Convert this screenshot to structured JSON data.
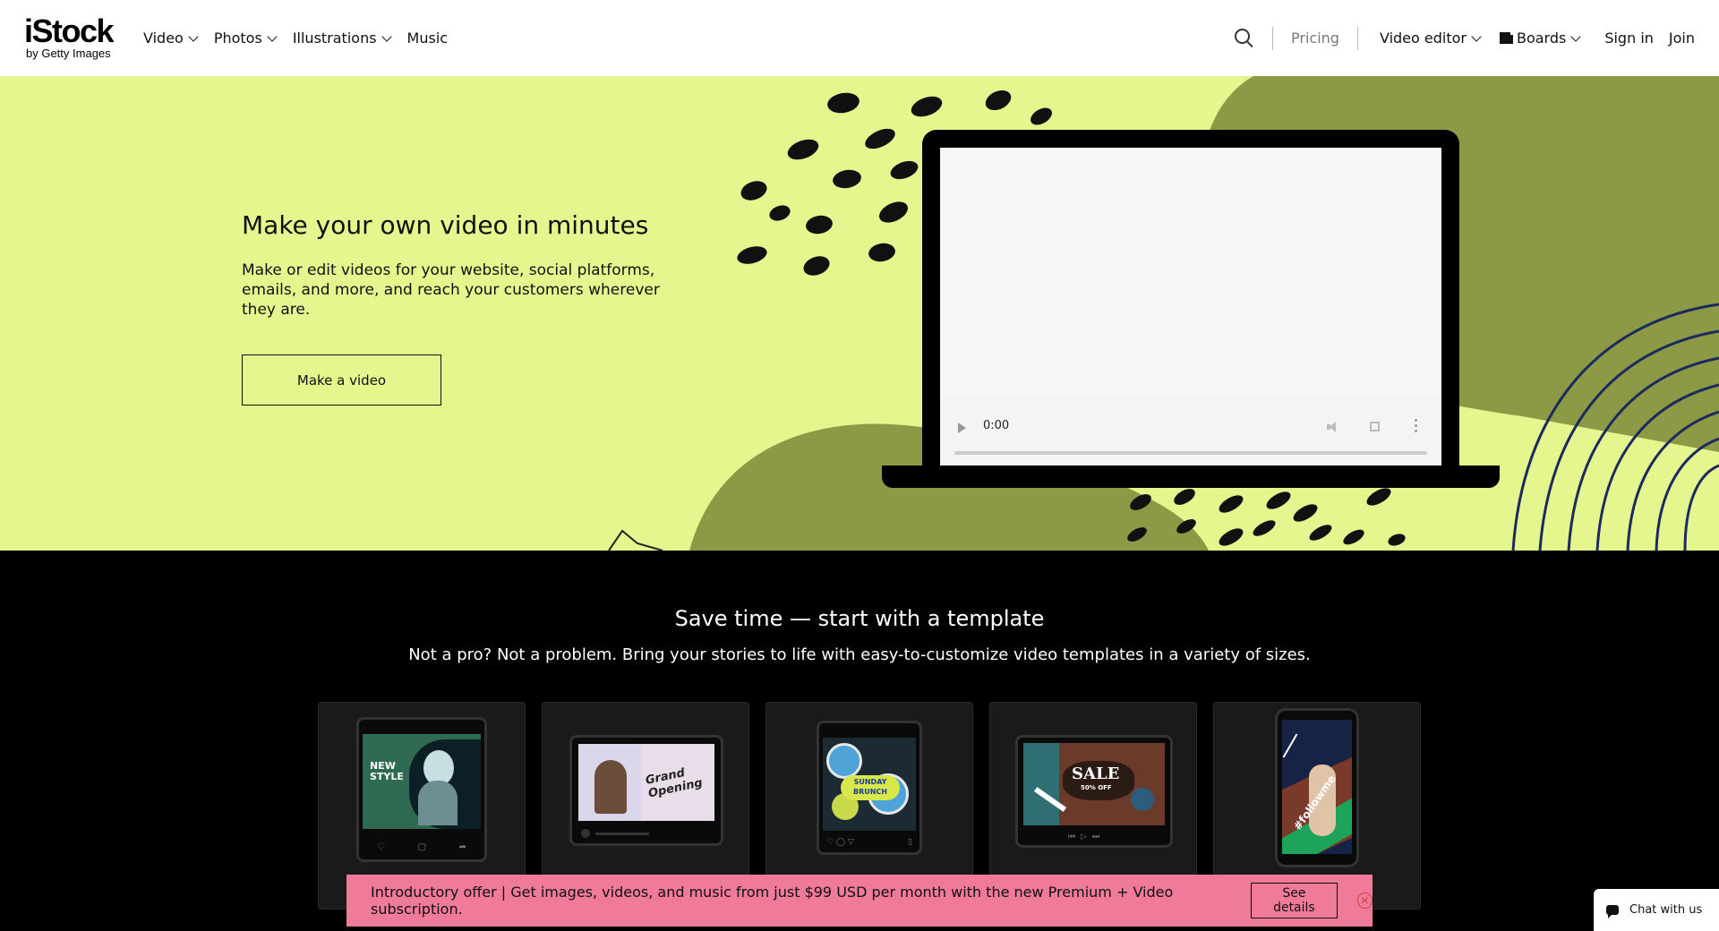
{
  "brand": {
    "name": "iStock",
    "byline": "by Getty Images"
  },
  "nav": {
    "left": [
      {
        "label": "Video",
        "dropdown": true
      },
      {
        "label": "Photos",
        "dropdown": true
      },
      {
        "label": "Illustrations",
        "dropdown": true
      },
      {
        "label": "Music",
        "dropdown": false
      }
    ],
    "pricing": "Pricing",
    "video_editor": "Video editor",
    "boards": "Boards",
    "sign_in": "Sign in",
    "join": "Join"
  },
  "hero": {
    "title": "Make your own video in minutes",
    "description": "Make or edit videos for your website, social platforms, emails, and more, and reach your customers wherever they are.",
    "cta": "Make a video",
    "background_color": "#e6f68e",
    "accent_color": "#8c9a45"
  },
  "video_player": {
    "time": "0:00",
    "progress": 0
  },
  "templates": {
    "title": "Save time — start with a template",
    "subtitle": "Not a pro? Not a problem. Bring your stories to life with easy-to-customize video templates in a variety of sizes.",
    "cards": [
      {
        "text": "NEW STYLE",
        "format": "square-post"
      },
      {
        "text": "Grand Opening",
        "format": "landscape"
      },
      {
        "text": "SUNDAY BRUNCH",
        "format": "square-post"
      },
      {
        "text": "SALE",
        "subtext": "50% OFF",
        "format": "landscape"
      },
      {
        "text": "#followme",
        "format": "vertical-story"
      }
    ]
  },
  "promo": {
    "text": "Introductory offer | Get images, videos, and music from just $99 USD per month with the new Premium + Video subscription.",
    "button": "See details",
    "close": "✕",
    "color": "#f07a99"
  },
  "chat": {
    "label": "Chat with us"
  }
}
